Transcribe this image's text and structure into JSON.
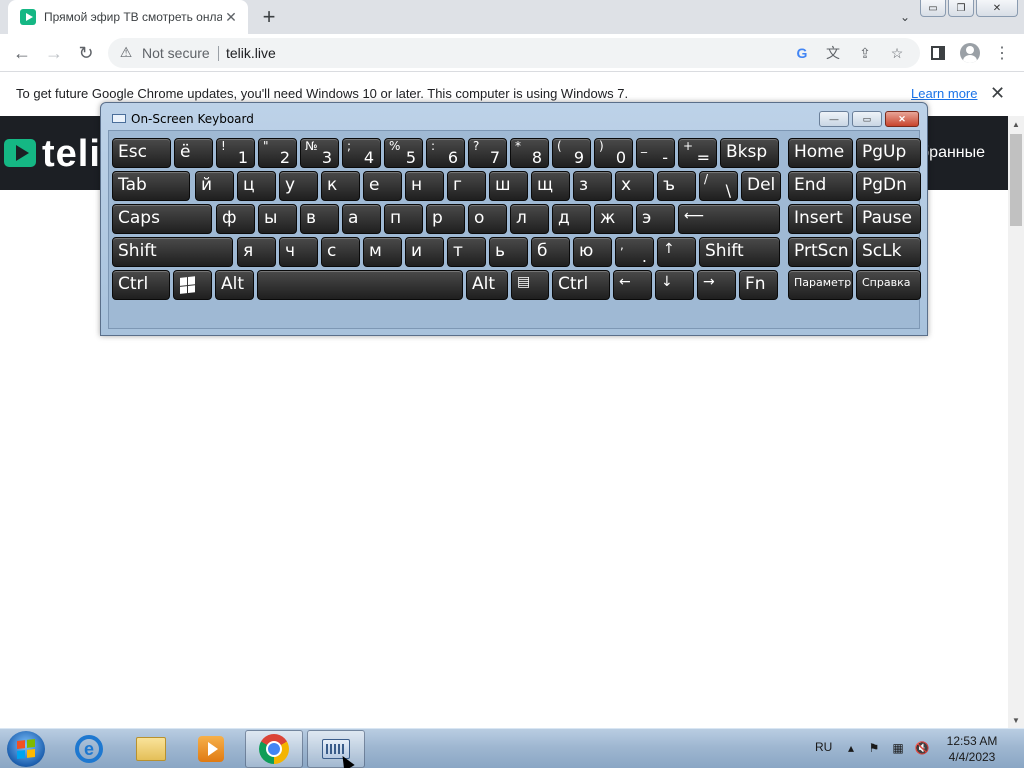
{
  "browser": {
    "tab_title": "Прямой эфир ТВ смотреть онлайн",
    "tab_close": "✕",
    "newtab": "+",
    "tabsearch": "⌄",
    "window_controls": [
      "▭",
      "❐",
      "✕"
    ],
    "nav": {
      "back": "←",
      "forward": "→",
      "reload": "↻"
    },
    "omnibox": {
      "security_icon": "warning-triangle",
      "security_text": "Not secure",
      "url": "telik.live"
    },
    "icons": [
      "google-g",
      "translate",
      "share",
      "bookmark-star",
      "sidebar",
      "profile",
      "menu"
    ]
  },
  "infobar": {
    "text": "To get future Google Chrome updates, you'll need Windows 10 or later. This computer is using Windows 7.",
    "link": "Learn more",
    "close": "✕"
  },
  "site": {
    "logo_text": "teli",
    "nav_right": "бранные",
    "accent": "#15b784",
    "header_bg": "#1c1f24"
  },
  "osk": {
    "title": "On-Screen Keyboard",
    "controls": {
      "minimize": "—",
      "restore": "▭",
      "close": "✕"
    },
    "rows": [
      [
        {
          "l": "Esc"
        },
        {
          "l": "ё"
        },
        {
          "t": "!",
          "b": "1"
        },
        {
          "t": "\"",
          "b": "2"
        },
        {
          "t": "№",
          "b": "3"
        },
        {
          "t": ";",
          "b": "4"
        },
        {
          "t": "%",
          "b": "5"
        },
        {
          "t": ":",
          "b": "6"
        },
        {
          "t": "?",
          "b": "7"
        },
        {
          "t": "*",
          "b": "8"
        },
        {
          "t": "(",
          "b": "9"
        },
        {
          "t": ")",
          "b": "0"
        },
        {
          "t": "_",
          "b": "-"
        },
        {
          "t": "+",
          "b": "="
        },
        {
          "l": "Bksp"
        },
        {
          "l": "Home"
        },
        {
          "l": "PgUp"
        }
      ],
      [
        {
          "l": "Tab"
        },
        {
          "l": "й"
        },
        {
          "l": "ц"
        },
        {
          "l": "у"
        },
        {
          "l": "к"
        },
        {
          "l": "е"
        },
        {
          "l": "н"
        },
        {
          "l": "г"
        },
        {
          "l": "ш"
        },
        {
          "l": "щ"
        },
        {
          "l": "з"
        },
        {
          "l": "х"
        },
        {
          "l": "ъ"
        },
        {
          "t": "/",
          "b": "\\"
        },
        {
          "l": "Del"
        },
        {
          "l": "End"
        },
        {
          "l": "PgDn"
        }
      ],
      [
        {
          "l": "Caps"
        },
        {
          "l": "ф"
        },
        {
          "l": "ы"
        },
        {
          "l": "в"
        },
        {
          "l": "а"
        },
        {
          "l": "п"
        },
        {
          "l": "р"
        },
        {
          "l": "о"
        },
        {
          "l": "л"
        },
        {
          "l": "д"
        },
        {
          "l": "ж"
        },
        {
          "l": "э"
        },
        {
          "l": "⟵"
        },
        {
          "l": "Insert"
        },
        {
          "l": "Pause"
        }
      ],
      [
        {
          "l": "Shift"
        },
        {
          "l": "я"
        },
        {
          "l": "ч"
        },
        {
          "l": "с"
        },
        {
          "l": "м"
        },
        {
          "l": "и"
        },
        {
          "l": "т"
        },
        {
          "l": "ь"
        },
        {
          "l": "б"
        },
        {
          "l": "ю"
        },
        {
          "t": ",",
          "b": "."
        },
        {
          "l": "↑"
        },
        {
          "l": "Shift"
        },
        {
          "l": "PrtScn"
        },
        {
          "l": "ScLk"
        }
      ],
      [
        {
          "l": "Ctrl"
        },
        {
          "l": "windows-logo"
        },
        {
          "l": "Alt"
        },
        {
          "l": ""
        },
        {
          "l": "Alt"
        },
        {
          "l": "▤"
        },
        {
          "l": "Ctrl"
        },
        {
          "l": "←"
        },
        {
          "l": "↓"
        },
        {
          "l": "→"
        },
        {
          "l": "Fn"
        },
        {
          "l": "Параметры"
        },
        {
          "l": "Справка"
        }
      ]
    ]
  },
  "taskbar": {
    "apps": [
      "internet-explorer",
      "windows-explorer",
      "media-player",
      "google-chrome",
      "on-screen-keyboard"
    ],
    "tray": {
      "lang": "RU",
      "icons": [
        "show-hidden-icons",
        "action-center-flag",
        "network",
        "volume-muted"
      ],
      "time": "12:53 AM",
      "date": "4/4/2023"
    }
  }
}
